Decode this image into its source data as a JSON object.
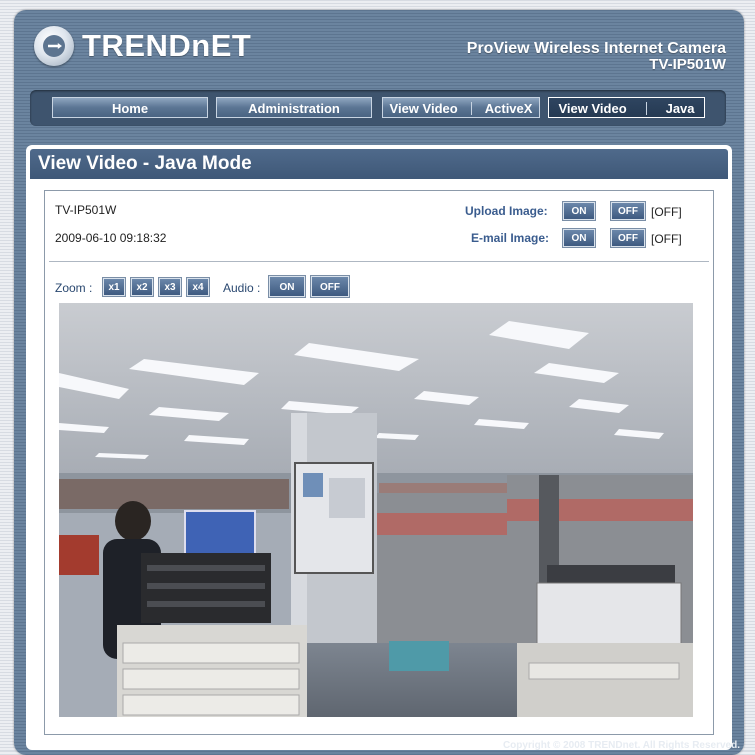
{
  "brand": {
    "logo_text": "TRENDnET"
  },
  "product": {
    "line1": "ProView Wireless Internet Camera",
    "line2": "TV-IP501W"
  },
  "nav": {
    "home": "Home",
    "administration": "Administration",
    "view_video_activex": {
      "left": "View Video",
      "right": "ActiveX"
    },
    "view_video_java": {
      "left": "View Video",
      "right": "Java"
    }
  },
  "page": {
    "title": "View Video - Java Mode"
  },
  "camera": {
    "model": "TV-IP501W",
    "datetime": "2009-06-10 09:18:32"
  },
  "upload_image": {
    "label": "Upload Image:",
    "on": "ON",
    "off": "OFF",
    "state": "[OFF]"
  },
  "email_image": {
    "label": "E-mail Image:",
    "on": "ON",
    "off": "OFF",
    "state": "[OFF]"
  },
  "zoom": {
    "label": "Zoom :",
    "options": [
      "x1",
      "x2",
      "x3",
      "x4"
    ]
  },
  "audio": {
    "label": "Audio :",
    "on": "ON",
    "off": "OFF"
  },
  "footer": {
    "copyright": "Copyright © 2008 TRENDnet. All Rights Reserved."
  },
  "colors": {
    "frame": "#5d7590",
    "nav_bar": "#3e546e",
    "title_bar": "#4f6a8b",
    "label_blue": "#3a5c8e"
  }
}
